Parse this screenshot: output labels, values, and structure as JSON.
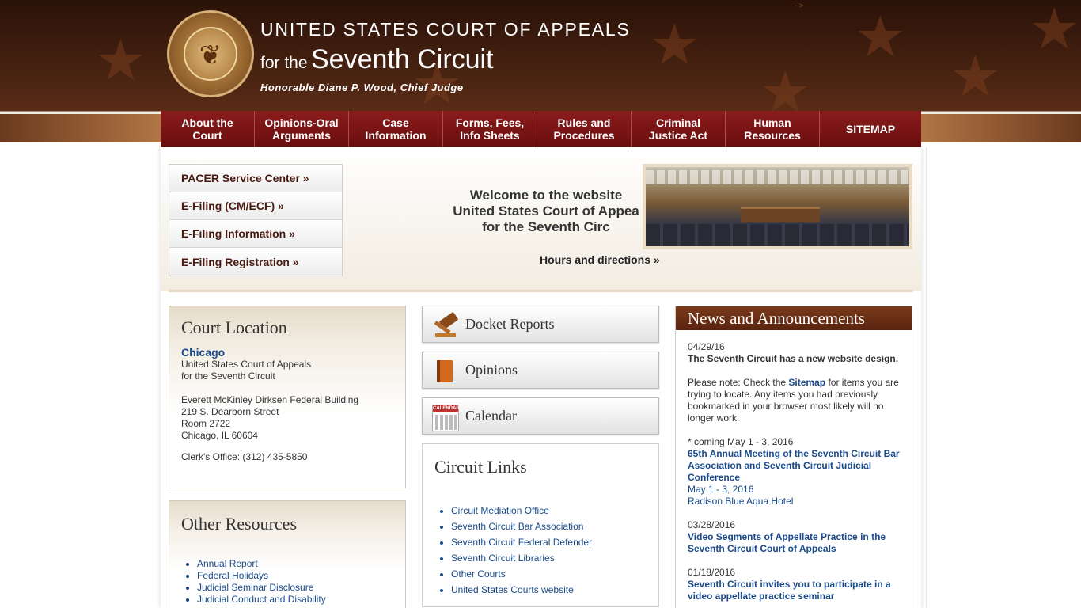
{
  "header": {
    "title_line1": "UNITED STATES COURT OF APPEALS",
    "title_for": "for the",
    "title_circuit": "Seventh Circuit",
    "subtitle": "Honorable Diane P. Wood, Chief Judge",
    "corner_text": "-->",
    "seal_icon": "court-seal-icon"
  },
  "nav": {
    "items": [
      "About the\nCourt",
      "Opinions-Oral\nArguments",
      "Case\nInformation",
      "Forms, Fees,\nInfo Sheets",
      "Rules and\nProcedures",
      "Criminal\nJustice Act",
      "Human\nResources",
      "SITEMAP"
    ]
  },
  "quick_links": [
    "PACER Service Center »",
    "E-Filing (CM/ECF) »",
    "E-Filing Information »",
    "E-Filing Registration »"
  ],
  "welcome": {
    "line1": "Welcome to the website",
    "line2": "United States Court of Appea",
    "line3": "for the Seventh Circ",
    "hours_link": "Hours and directions »"
  },
  "court_location": {
    "title": "Court Location",
    "city": "Chicago",
    "lines_a": [
      "United States Court of Appeals",
      "for the Seventh Circuit"
    ],
    "lines_b": [
      "Everett McKinley Dirksen Federal Building",
      "219 S. Dearborn Street",
      "Room 2722",
      "Chicago, IL 60604"
    ],
    "clerk": "Clerk's Office: (312) 435-5850"
  },
  "other_resources": {
    "title": "Other Resources",
    "items": [
      "Annual Report",
      "Federal Holidays",
      "Judicial Seminar Disclosure",
      "Judicial Conduct and Disability"
    ]
  },
  "buttons": {
    "docket": "Docket Reports",
    "opinions": "Opinions",
    "calendar": "Calendar",
    "calendar_icon_text": "CALENDAR"
  },
  "circuit_links": {
    "title": "Circuit Links",
    "items": [
      "Circuit Mediation Office",
      "Seventh Circuit Bar Association",
      "Seventh Circuit Federal Defender",
      "Seventh Circuit Libraries",
      "Other Courts",
      "United States Courts website"
    ]
  },
  "news": {
    "title": "News and Announcements",
    "n1_date": "04/29/16",
    "n1_head": "The Seventh Circuit has a new website design.",
    "n1_pre": "Please note: Check the ",
    "n1_link": "Sitemap",
    "n1_post": " for items you are trying to locate. Any items you had previously bookmarked in your browser most likely will no longer work.",
    "n2_note": "* coming May 1 - 3, 2016",
    "n2_link": "65th Annual Meeting of the Seventh Circuit Bar Association and Seventh Circuit Judicial Conference",
    "n2_dates": "May 1 - 3, 2016",
    "n2_place": "Radison Blue Aqua Hotel",
    "n3_date": "03/28/2016",
    "n3_link": "Video Segments of Appellate Practice in the Seventh Circuit Court of Appeals",
    "n4_date": "01/18/2016",
    "n4_link": "Seventh Circuit invites you to participate in a video appellate practice seminar"
  }
}
